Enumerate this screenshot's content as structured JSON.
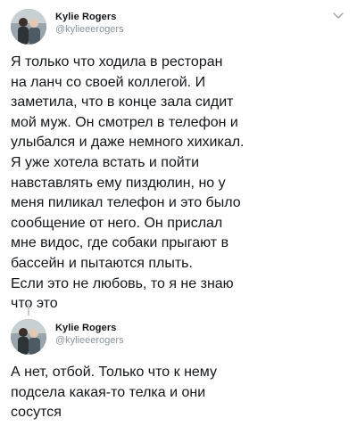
{
  "tweets": [
    {
      "author": {
        "name": "Kylie Rogers",
        "handle": "@kylieeerogers"
      },
      "text": "Я только что ходила в ресторан\nна ланч со своей коллегой. И\nзаметила, что в конце зала сидит\nмой муж. Он смотрел в телефон и\nулыбался и даже немного хихикал.\nЯ уже хотела встать и пойти\nнавставлять ему пиздюлин, но у\nменя пиликал телефон и это было\nсообщение от него. Он прислал\nмне видос, где собаки прыгают в\nбассейн и пытаются плыть.\nЕсли это не любовь, то я не знаю\nчто это",
      "menu_icon": "chevron-down-icon"
    },
    {
      "author": {
        "name": "Kylie Rogers",
        "handle": "@kylieeerogers"
      },
      "text": "А нет, отбой. Только что к нему\nподсела какая-то телка и они\nсосутся"
    }
  ],
  "colors": {
    "text": "#14171a",
    "secondary": "#8a949c",
    "thread_line": "#c4cfd6"
  }
}
